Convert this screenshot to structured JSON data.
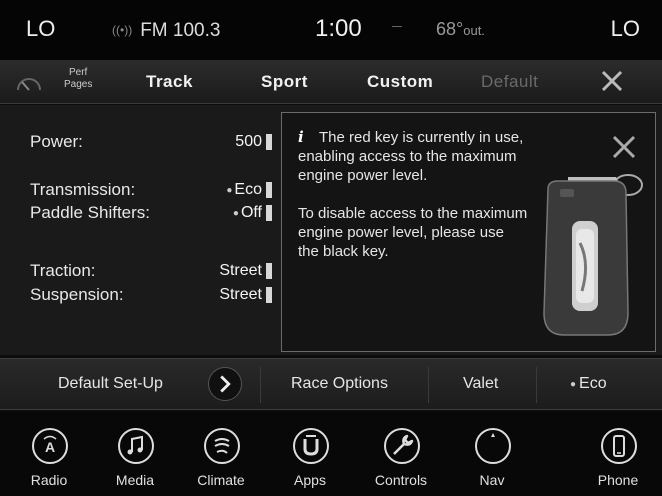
{
  "status": {
    "lo_left": "LO",
    "radio": "FM 100.3",
    "clock": "1:00",
    "temp": "68°",
    "temp_suffix": "out.",
    "lo_right": "LO"
  },
  "tabs": {
    "perf_line1": "Perf",
    "perf_line2": "Pages",
    "items": [
      "Track",
      "Sport",
      "Custom",
      "Default"
    ]
  },
  "settings": [
    {
      "label": "Power:",
      "value": "500"
    },
    {
      "label": "Transmission:",
      "value": "Eco"
    },
    {
      "label": "Paddle Shifters:",
      "value": "Off"
    },
    {
      "label": "Traction:",
      "value": "Street"
    },
    {
      "label": "Suspension:",
      "value": "Street"
    }
  ],
  "popup": {
    "info_icon": "i",
    "para1": "The red key is currently in use, enabling access to the maximum engine power level.",
    "para2": "To disable access to the maximum engine power level, please use the black key."
  },
  "functions": {
    "default_setup": "Default Set-Up",
    "race_options": "Race Options",
    "valet": "Valet",
    "eco": "Eco"
  },
  "nav": [
    {
      "label": "Radio",
      "icon": "radio-icon"
    },
    {
      "label": "Media",
      "icon": "media-icon"
    },
    {
      "label": "Climate",
      "icon": "climate-icon"
    },
    {
      "label": "Apps",
      "icon": "apps-icon"
    },
    {
      "label": "Controls",
      "icon": "controls-icon"
    },
    {
      "label": "Nav",
      "icon": "nav-icon"
    },
    {
      "label": "Phone",
      "icon": "phone-icon"
    }
  ]
}
